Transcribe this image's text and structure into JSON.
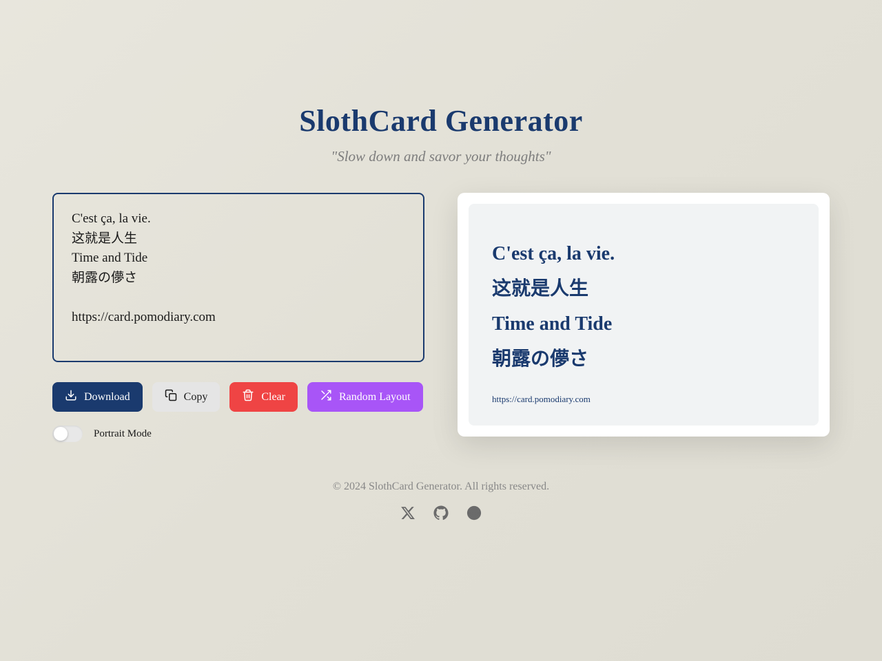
{
  "header": {
    "title": "SlothCard Generator",
    "subtitle": "\"Slow down and savor your thoughts\""
  },
  "editor": {
    "value": "C'est ça, la vie.\n这就是人生\nTime and Tide\n朝露の儚さ\n\nhttps://card.pomodiary.com"
  },
  "buttons": {
    "download": "Download",
    "copy": "Copy",
    "clear": "Clear",
    "random": "Random Layout"
  },
  "toggle": {
    "portrait_label": "Portrait Mode",
    "portrait_on": false
  },
  "card": {
    "lines": [
      "C'est ça, la vie.",
      "这就是人生",
      "Time and Tide",
      "朝露の儚さ"
    ],
    "url": "https://card.pomodiary.com"
  },
  "footer": {
    "copyright": "© 2024 SlothCard Generator. All rights reserved."
  }
}
